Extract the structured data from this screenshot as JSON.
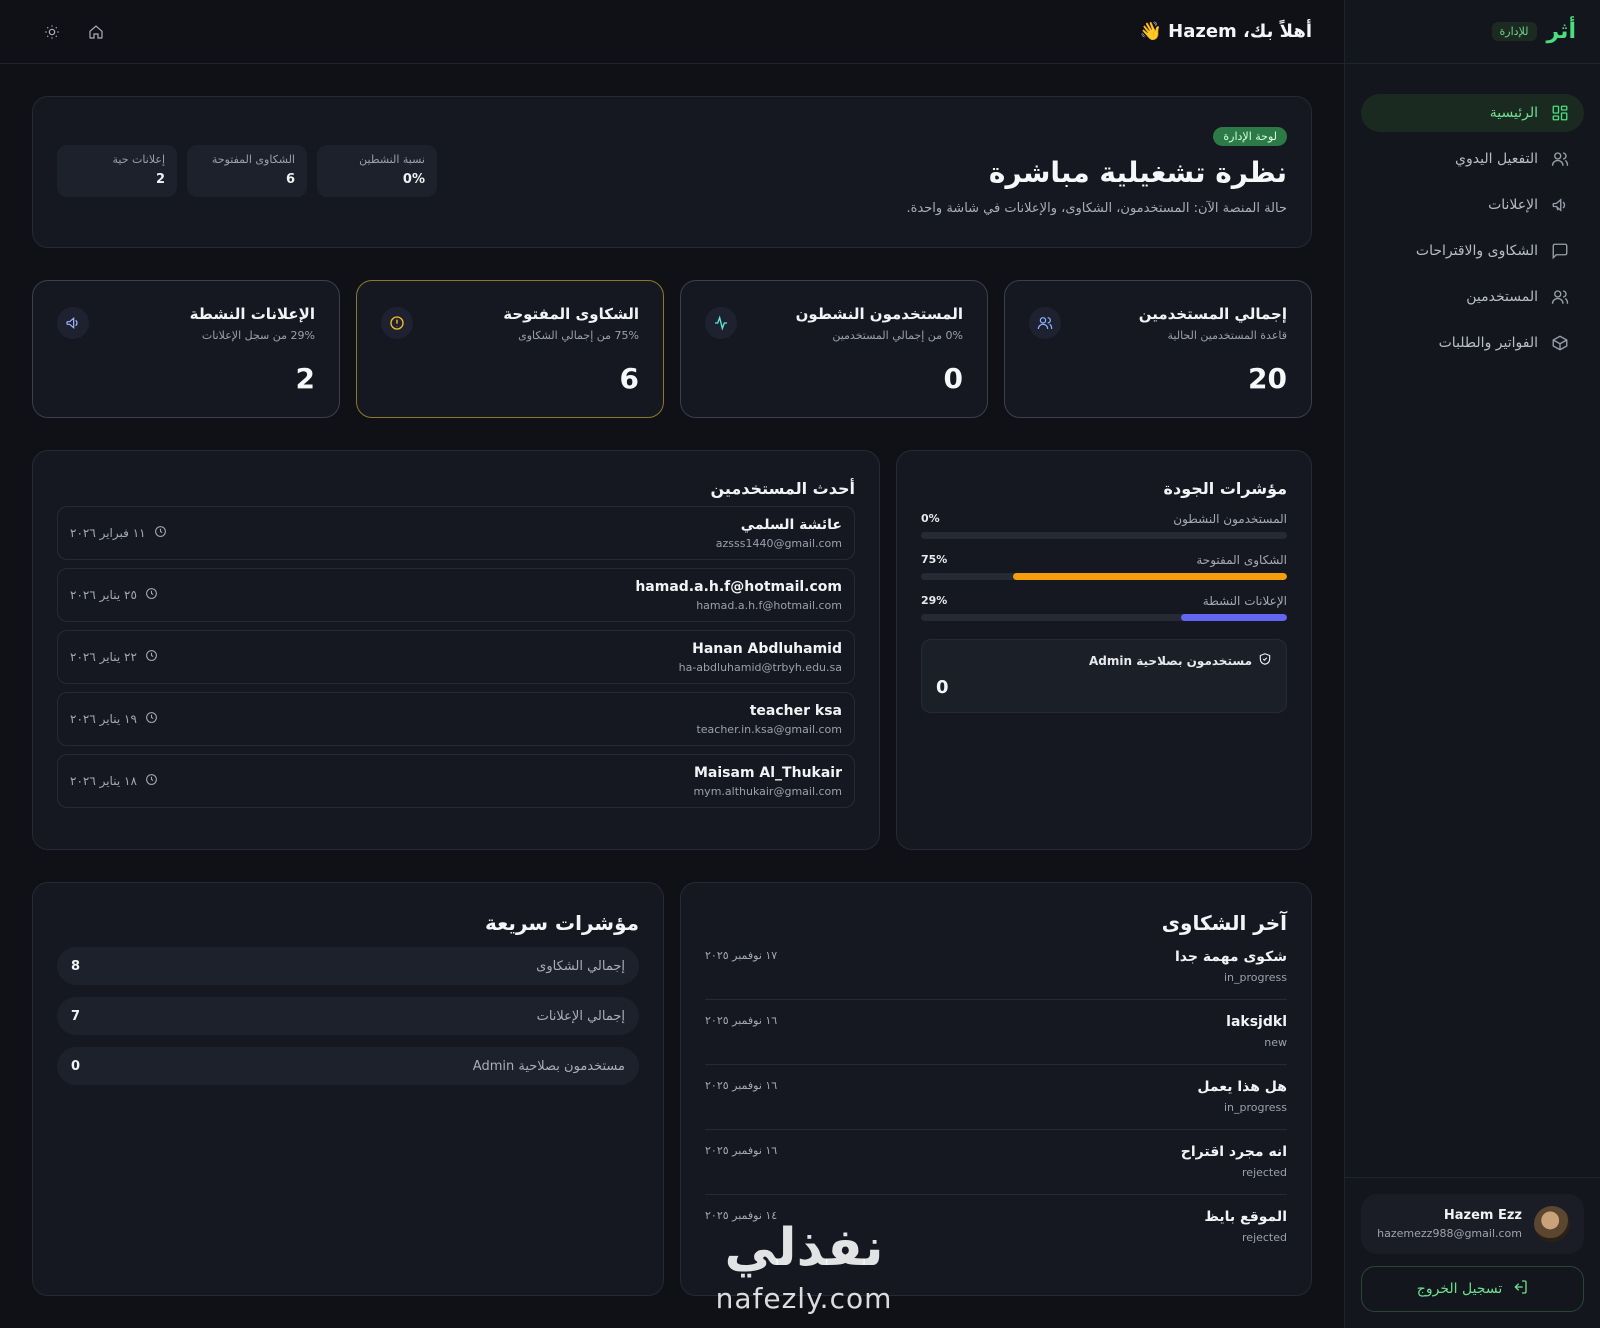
{
  "brand": {
    "logo": "أثر",
    "badge": "للإدارة"
  },
  "sidebar": {
    "items": [
      {
        "label": "الرئيسية",
        "icon": "dashboard-icon",
        "active": true
      },
      {
        "label": "التفعيل اليدوي",
        "icon": "user-check-icon"
      },
      {
        "label": "الإعلانات",
        "icon": "megaphone-icon"
      },
      {
        "label": "الشكاوى والاقتراحات",
        "icon": "message-square-icon"
      },
      {
        "label": "المستخدمين",
        "icon": "users-icon"
      },
      {
        "label": "الفواتير والطلبات",
        "icon": "package-icon"
      }
    ],
    "user": {
      "name": "Hazem Ezz",
      "email": "hazemezz988@gmail.com"
    },
    "logout_label": "تسجيل الخروج"
  },
  "header": {
    "greeting": "أهلاً بك، Hazem 👋"
  },
  "hero": {
    "pill": "لوحة الإدارة",
    "title": "نظرة تشغيلية مباشرة",
    "subtitle": "حالة المنصة الآن: المستخدمون، الشكاوى، والإعلانات في شاشة واحدة.",
    "mini": [
      {
        "label": "نسبة النشطين",
        "value": "0%"
      },
      {
        "label": "الشكاوى المفتوحة",
        "value": "6"
      },
      {
        "label": "إعلانات حية",
        "value": "2"
      }
    ]
  },
  "stats": [
    {
      "title": "إجمالي المستخدمين",
      "sub": "قاعدة المستخدمين الحالية",
      "value": "20",
      "icon": "users-icon"
    },
    {
      "title": "المستخدمون النشطون",
      "sub": "0% من إجمالي المستخدمين",
      "value": "0",
      "icon": "activity-icon"
    },
    {
      "title": "الشكاوى المفتوحة",
      "sub": "75% من إجمالي الشكاوى",
      "value": "6",
      "icon": "alert-circle-icon"
    },
    {
      "title": "الإعلانات النشطة",
      "sub": "29% من سجل الإعلانات",
      "value": "2",
      "icon": "megaphone-icon"
    }
  ],
  "latest_users": {
    "title": "أحدث المستخدمين",
    "rows": [
      {
        "name": "عائشة السلمي",
        "email": "azsss1440@gmail.com",
        "date": "١١ فبراير ٢٠٢٦"
      },
      {
        "name": "hamad.a.h.f@hotmail.com",
        "email": "hamad.a.h.f@hotmail.com",
        "date": "٢٥ يناير ٢٠٢٦"
      },
      {
        "name": "Hanan Abdluhamid",
        "email": "ha-abdluhamid@trbyh.edu.sa",
        "date": "٢٢ يناير ٢٠٢٦"
      },
      {
        "name": "teacher ksa",
        "email": "teacher.in.ksa@gmail.com",
        "date": "١٩ يناير ٢٠٢٦"
      },
      {
        "name": "Maisam Al_Thukair",
        "email": "mym.althukair@gmail.com",
        "date": "١٨ يناير ٢٠٢٦"
      }
    ]
  },
  "quality": {
    "title": "مؤشرات الجودة",
    "items": [
      {
        "label": "المستخدمون النشطون",
        "pct_label": "0%",
        "fraction": 0.0,
        "color": "#3b82f6"
      },
      {
        "label": "الشكاوى المفتوحة",
        "pct_label": "75%",
        "fraction": 0.75,
        "color": "#f59e0b"
      },
      {
        "label": "الإعلانات النشطة",
        "pct_label": "29%",
        "fraction": 0.29,
        "color": "#6366f1"
      }
    ],
    "admin_label": "مستخدمون بصلاحية Admin",
    "admin_value": "0"
  },
  "quick": {
    "title": "مؤشرات سريعة",
    "rows": [
      {
        "label": "إجمالي الشكاوى",
        "value": "8"
      },
      {
        "label": "إجمالي الإعلانات",
        "value": "7"
      },
      {
        "label": "مستخدمون بصلاحية Admin",
        "value": "0"
      }
    ]
  },
  "complaints": {
    "title": "آخر الشكاوى",
    "rows": [
      {
        "title": "شكوى مهمة جدا",
        "status": "in_progress",
        "date": "١٧ نوفمبر ٢٠٢٥"
      },
      {
        "title": "laksjdkl",
        "status": "new",
        "date": "١٦ نوفمبر ٢٠٢٥"
      },
      {
        "title": "هل هذا يعمل",
        "status": "in_progress",
        "date": "١٦ نوفمبر ٢٠٢٥"
      },
      {
        "title": "انه مجرد اقتراح",
        "status": "rejected",
        "date": "١٦ نوفمبر ٢٠٢٥"
      },
      {
        "title": "الموقع بايظ",
        "status": "rejected",
        "date": "١٤ نوفمبر ٢٠٢٥"
      }
    ]
  },
  "watermark": {
    "arabic": "نفذلي",
    "latin": "nafezly.com"
  },
  "colors": {
    "accent": "#4ade80",
    "background": "#0f1117",
    "card": "#151821",
    "warning": "#f59e0b",
    "indigo": "#6366f1"
  }
}
